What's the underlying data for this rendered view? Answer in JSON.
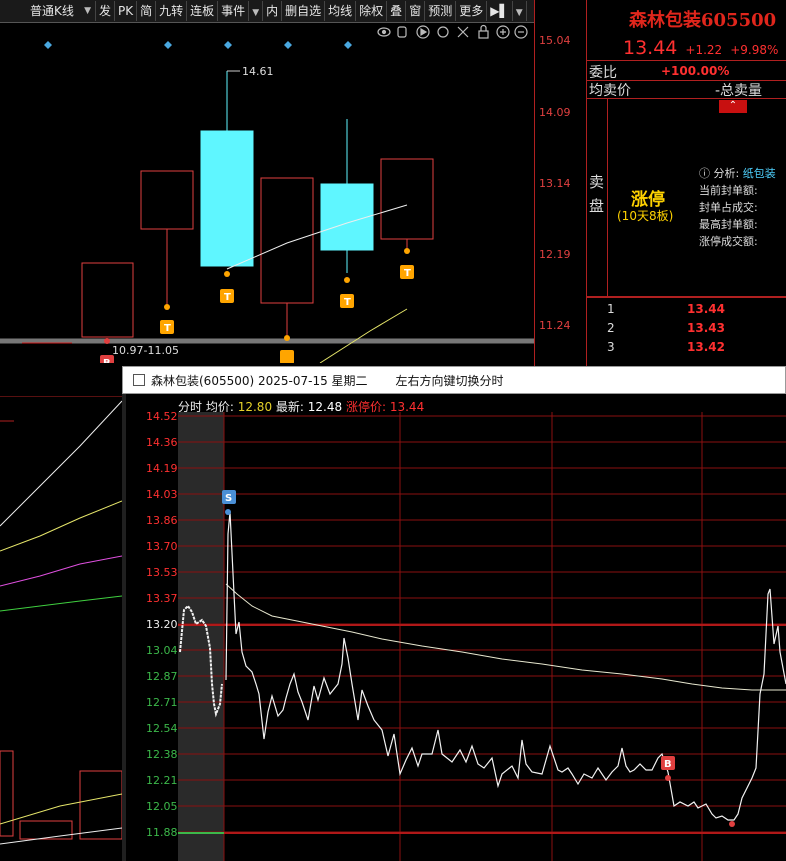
{
  "toolbar": {
    "chart_type": "普通K线",
    "items": [
      "发",
      "PK",
      "简",
      "九转",
      "连板",
      "事件",
      "内",
      "删自选",
      "均线",
      "除权",
      "叠",
      "窗",
      "预测",
      "更多"
    ]
  },
  "kline": {
    "price_axis": [
      "15.04",
      "14.09",
      "13.14",
      "12.19",
      "11.24"
    ],
    "high_label": "14.61",
    "range_label": "10.97-11.05",
    "markers": {
      "buy": "B",
      "sell": "S",
      "t": "T"
    }
  },
  "panel": {
    "stock_name": "森林包装",
    "stock_code": "605500",
    "price": "13.44",
    "change": "+1.22",
    "change_pct": "+9.98%",
    "weibi_label": "委比",
    "weibi_value": "+100.00%",
    "avg_label": "均卖价",
    "total_label": "-总卖量",
    "sell_label": [
      "卖",
      "盘"
    ],
    "limit_up": "涨停",
    "limit_up_sub": "(10天8板)",
    "analysis_label": "分析:",
    "analysis_link": "纸包装",
    "info_rows": [
      "当前封单额:",
      "封单占成交:",
      "最高封单额:",
      "涨停成交额:"
    ],
    "orderbook": [
      {
        "level": "1",
        "price": "13.44"
      },
      {
        "level": "2",
        "price": "13.43"
      },
      {
        "level": "3",
        "price": "13.42"
      }
    ]
  },
  "popup": {
    "title": "森林包装(605500) 2025-07-15 星期二",
    "hint": "左右方向键切换分时",
    "header_label": "分时",
    "avg_label": "均价:",
    "avg_value": "12.80",
    "last_label": "最新:",
    "last_value": "12.48",
    "limit_label": "涨停价:",
    "limit_value": "13.44",
    "price_axis": [
      "14.52",
      "14.36",
      "14.19",
      "14.03",
      "13.86",
      "13.70",
      "13.53",
      "13.37",
      "13.20",
      "13.04",
      "12.87",
      "12.71",
      "12.54",
      "12.38",
      "12.21",
      "12.05",
      "11.88"
    ],
    "prev_close_index": 8
  },
  "colors": {
    "up": "#ff3030",
    "down": "#3cb84a",
    "cyan": "#5ff6ff",
    "grid": "#8a1010",
    "marker": "#ffa500"
  }
}
